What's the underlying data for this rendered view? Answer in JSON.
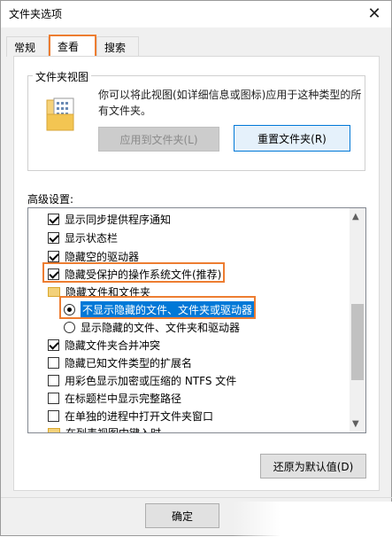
{
  "window": {
    "title": "文件夹选项"
  },
  "tabs": [
    {
      "label": "常规",
      "active": false
    },
    {
      "label": "查看",
      "active": true
    },
    {
      "label": "搜索",
      "active": false
    }
  ],
  "folder_views": {
    "title": "文件夹视图",
    "description_line1": "你可以将此视图(如详细信息或图标)应用于这种类型的所",
    "description_line2": "有文件夹。",
    "apply_button": "应用到文件夹(L)",
    "reset_button": "重置文件夹(R)"
  },
  "advanced": {
    "label": "高级设置:",
    "items": [
      {
        "label": "显示同步提供程序通知",
        "type": "checkbox",
        "checked": true
      },
      {
        "label": "显示状态栏",
        "type": "checkbox",
        "checked": true
      },
      {
        "label": "隐藏空的驱动器",
        "type": "checkbox",
        "checked": true
      },
      {
        "label": "隐藏受保护的操作系统文件(推荐)",
        "type": "checkbox",
        "checked": true
      },
      {
        "label": "隐藏文件和文件夹",
        "type": "folder"
      },
      {
        "label": "不显示隐藏的文件、文件夹或驱动器",
        "type": "radio",
        "checked": true
      },
      {
        "label": "显示隐藏的文件、文件夹和驱动器",
        "type": "radio",
        "checked": false
      },
      {
        "label": "隐藏文件夹合并冲突",
        "type": "checkbox",
        "checked": true
      },
      {
        "label": "隐藏已知文件类型的扩展名",
        "type": "checkbox",
        "checked": false
      },
      {
        "label": "用彩色显示加密或压缩的 NTFS 文件",
        "type": "checkbox",
        "checked": false
      },
      {
        "label": "在标题栏中显示完整路径",
        "type": "checkbox",
        "checked": false
      },
      {
        "label": "在单独的进程中打开文件夹窗口",
        "type": "checkbox",
        "checked": false
      },
      {
        "label": "在列表视图中键入时",
        "type": "folder"
      }
    ]
  },
  "restore_button": "还原为默认值(D)",
  "ok_button": "确定",
  "colors": {
    "accent": "#0078d7",
    "highlight": "#ed7d31"
  }
}
